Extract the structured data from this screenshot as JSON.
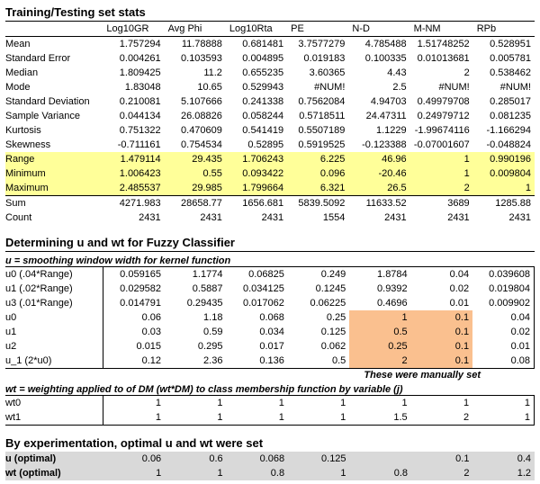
{
  "section1": {
    "title": "Training/Testing set stats",
    "headers": [
      "",
      "Log10GR",
      "Avg Phi",
      "Log10Rta",
      "PE",
      "N-D",
      "M-NM",
      "RPb"
    ],
    "rows": [
      {
        "label": "Mean",
        "v": [
          "1.757294",
          "11.78888",
          "0.681481",
          "3.7577279",
          "4.785488",
          "1.51748252",
          "0.528951"
        ],
        "hl": ""
      },
      {
        "label": "Standard Error",
        "v": [
          "0.004261",
          "0.103593",
          "0.004895",
          "0.019183",
          "0.100335",
          "0.01013681",
          "0.005781"
        ],
        "hl": ""
      },
      {
        "label": "Median",
        "v": [
          "1.809425",
          "11.2",
          "0.655235",
          "3.60365",
          "4.43",
          "2",
          "0.538462"
        ],
        "hl": ""
      },
      {
        "label": "Mode",
        "v": [
          "1.83048",
          "10.65",
          "0.529943",
          "#NUM!",
          "2.5",
          "#NUM!",
          "#NUM!"
        ],
        "hl": ""
      },
      {
        "label": "Standard Deviation",
        "v": [
          "0.210081",
          "5.107666",
          "0.241338",
          "0.7562084",
          "4.94703",
          "0.49979708",
          "0.285017"
        ],
        "hl": ""
      },
      {
        "label": "Sample Variance",
        "v": [
          "0.044134",
          "26.08826",
          "0.058244",
          "0.5718511",
          "24.47311",
          "0.24979712",
          "0.081235"
        ],
        "hl": ""
      },
      {
        "label": "Kurtosis",
        "v": [
          "0.751322",
          "0.470609",
          "0.541419",
          "0.5507189",
          "1.1229",
          "-1.99674116",
          "-1.166294"
        ],
        "hl": ""
      },
      {
        "label": "Skewness",
        "v": [
          "-0.711161",
          "0.754534",
          "0.52895",
          "0.5919525",
          "-0.123388",
          "-0.07001607",
          "-0.048824"
        ],
        "hl": ""
      },
      {
        "label": "Range",
        "v": [
          "1.479114",
          "29.435",
          "1.706243",
          "6.225",
          "46.96",
          "1",
          "0.990196"
        ],
        "hl": "y"
      },
      {
        "label": "Minimum",
        "v": [
          "1.006423",
          "0.55",
          "0.093422",
          "0.096",
          "-20.46",
          "1",
          "0.009804"
        ],
        "hl": "y"
      },
      {
        "label": "Maximum",
        "v": [
          "2.485537",
          "29.985",
          "1.799664",
          "6.321",
          "26.5",
          "2",
          "1"
        ],
        "hl": "y"
      },
      {
        "label": "Sum",
        "v": [
          "4271.983",
          "28658.77",
          "1656.681",
          "5839.5092",
          "11633.52",
          "3689",
          "1285.88"
        ],
        "hl": "",
        "sum": true
      },
      {
        "label": "Count",
        "v": [
          "2431",
          "2431",
          "2431",
          "1554",
          "2431",
          "2431",
          "2431"
        ],
        "hl": ""
      }
    ]
  },
  "section2": {
    "title": "Determining u and wt for Fuzzy Classifier",
    "sub_u": "u = smoothing window width for kernel function",
    "u_rows": [
      {
        "label": "u0 (.04*Range)",
        "v": [
          "0.059165",
          "1.1774",
          "0.06825",
          "0.249",
          "1.8784",
          "0.04",
          "0.039608"
        ]
      },
      {
        "label": "u1 (.02*Range)",
        "v": [
          "0.029582",
          "0.5887",
          "0.034125",
          "0.1245",
          "0.9392",
          "0.02",
          "0.019804"
        ]
      },
      {
        "label": "u3 (.01*Range)",
        "v": [
          "0.014791",
          "0.29435",
          "0.017062",
          "0.06225",
          "0.4696",
          "0.01",
          "0.009902"
        ]
      },
      {
        "label": "u0",
        "v": [
          "0.06",
          "1.18",
          "0.068",
          "0.25",
          "1",
          "0.1",
          "0.04"
        ],
        "o": [
          4,
          5
        ]
      },
      {
        "label": "u1",
        "v": [
          "0.03",
          "0.59",
          "0.034",
          "0.125",
          "0.5",
          "0.1",
          "0.02"
        ],
        "o": [
          4,
          5
        ]
      },
      {
        "label": "u2",
        "v": [
          "0.015",
          "0.295",
          "0.017",
          "0.062",
          "0.25",
          "0.1",
          "0.01"
        ],
        "o": [
          4,
          5
        ]
      },
      {
        "label": "u_1 (2*u0)",
        "v": [
          "0.12",
          "2.36",
          "0.136",
          "0.5",
          "2",
          "0.1",
          "0.08"
        ],
        "o": [
          4,
          5
        ]
      }
    ],
    "u_note": "These were manually set",
    "sub_wt": "wt = weighting applied to of DM (wt*DM) to class membership function by variable (j)",
    "wt_rows": [
      {
        "label": "wt0",
        "v": [
          "1",
          "1",
          "1",
          "1",
          "1",
          "1",
          "1"
        ]
      },
      {
        "label": "wt1",
        "v": [
          "1",
          "1",
          "1",
          "1",
          "1.5",
          "2",
          "1"
        ]
      }
    ]
  },
  "section3": {
    "title": "By experimentation, optimal u and wt were set",
    "rows": [
      {
        "label": "u   (optimal)",
        "v": [
          "0.06",
          "0.6",
          "0.068",
          "0.125",
          "",
          "0.1",
          "0.4"
        ]
      },
      {
        "label": "wt (optimal)",
        "v": [
          "1",
          "1",
          "0.8",
          "1",
          "0.8",
          "2",
          "1.2"
        ]
      }
    ]
  }
}
